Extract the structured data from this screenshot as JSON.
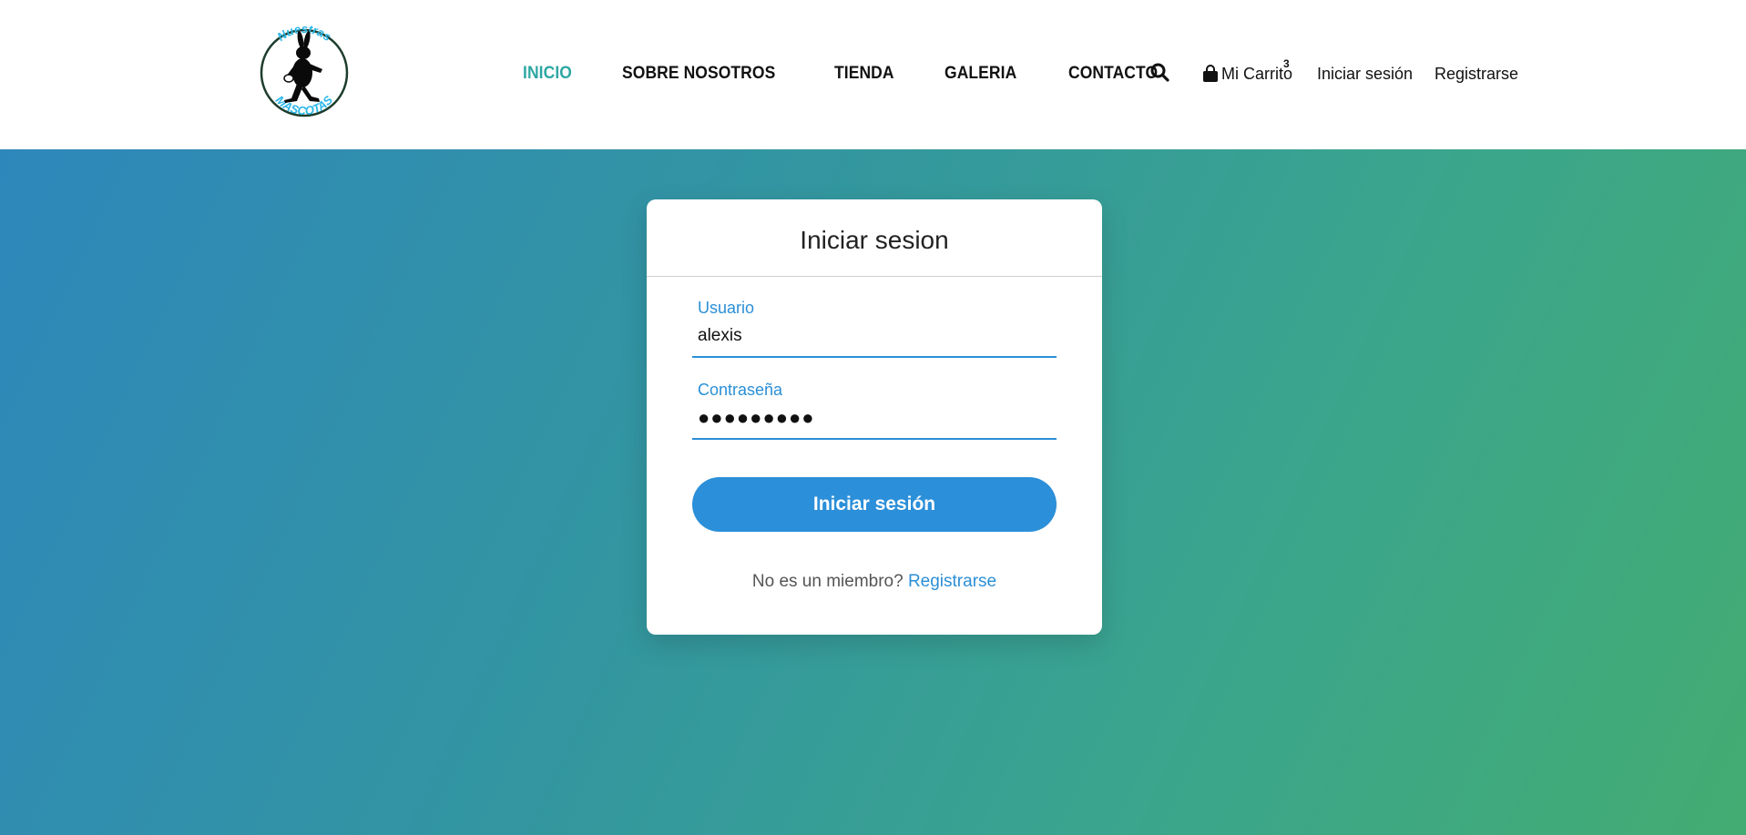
{
  "logo": {
    "top_text": "Nuestras",
    "bottom_text": "MASCOTAS",
    "accent_color": "#29b6e8"
  },
  "nav": {
    "items": [
      {
        "label": "INICIO",
        "active": true
      },
      {
        "label": "SOBRE NOSOTROS",
        "active": false
      },
      {
        "label": "TIENDA",
        "active": false
      },
      {
        "label": "GALERIA",
        "active": false
      },
      {
        "label": "CONTACTO",
        "active": false
      }
    ],
    "active_color": "#2ea7a3"
  },
  "header_actions": {
    "search_icon": "search-icon",
    "cart_icon": "shopping-bag-icon",
    "cart_label": "Mi Carrito",
    "cart_count": "3",
    "login_label": "Iniciar sesión",
    "register_label": "Registrarse"
  },
  "login_card": {
    "title": "Iniciar sesion",
    "username_label": "Usuario",
    "username_value": "alexis",
    "password_label": "Contraseña",
    "password_value": "●●●●●●●●●",
    "submit_label": "Iniciar sesión",
    "signup_prompt": "No es un miembro?",
    "signup_link": "Registrarse",
    "accent_color": "#2b8fd9"
  },
  "background": {
    "gradient_start": "#2e87bb",
    "gradient_end": "#43ac72"
  }
}
